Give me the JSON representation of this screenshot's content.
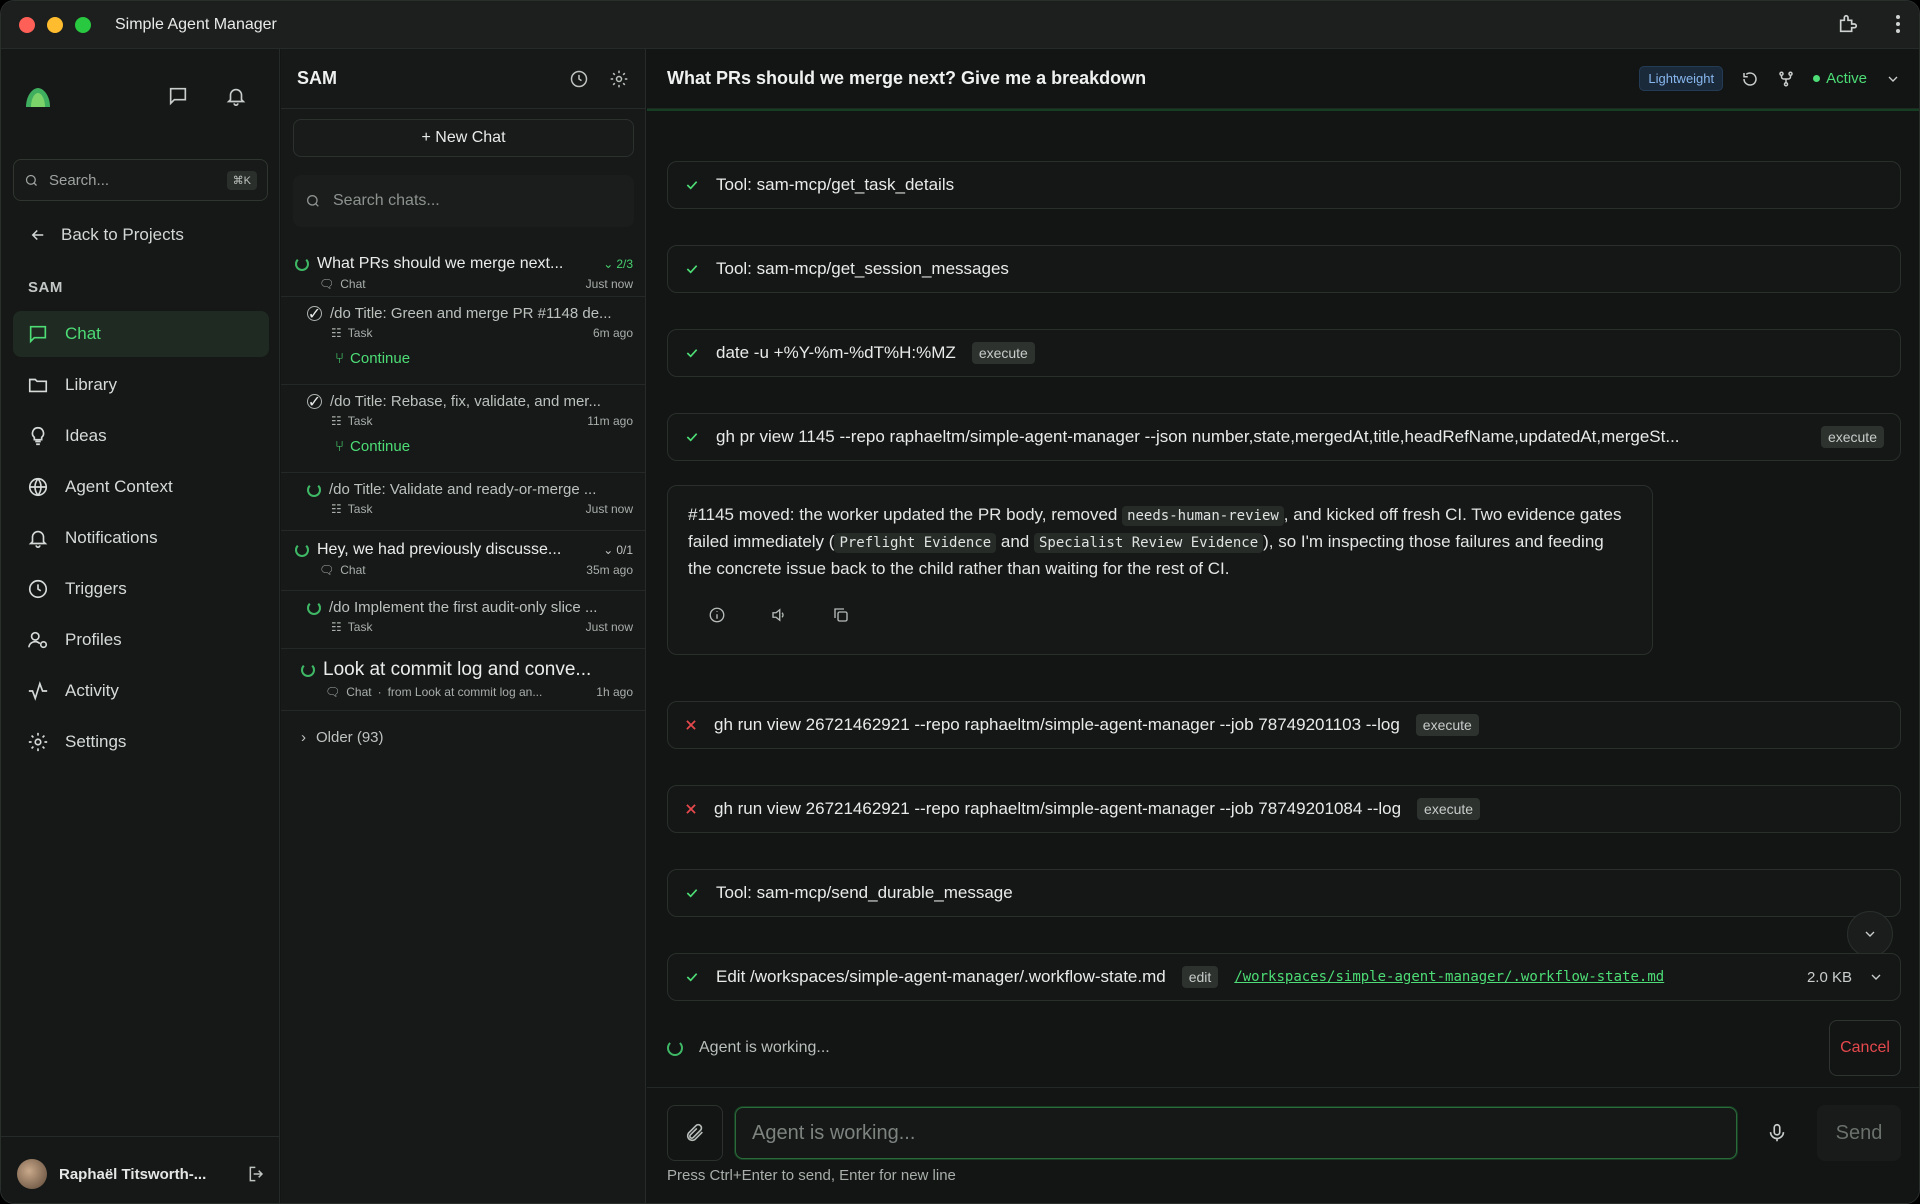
{
  "window": {
    "title": "Simple Agent Manager"
  },
  "sidebar": {
    "search_placeholder": "Search...",
    "search_shortcut": "⌘K",
    "back_label": "Back to Projects",
    "section": "SAM",
    "items": [
      {
        "label": "Chat",
        "icon": "chat-bubble-icon",
        "active": true
      },
      {
        "label": "Library",
        "icon": "folder-icon"
      },
      {
        "label": "Ideas",
        "icon": "lightbulb-icon"
      },
      {
        "label": "Agent Context",
        "icon": "globe-icon"
      },
      {
        "label": "Notifications",
        "icon": "bell-icon"
      },
      {
        "label": "Triggers",
        "icon": "clock-icon"
      },
      {
        "label": "Profiles",
        "icon": "user-gear-icon"
      },
      {
        "label": "Activity",
        "icon": "activity-icon"
      },
      {
        "label": "Settings",
        "icon": "gear-icon"
      }
    ],
    "user_name": "Raphaël Titsworth-..."
  },
  "chatlist": {
    "title": "SAM",
    "new_chat": "+ New Chat",
    "search_placeholder": "Search chats...",
    "threads": [
      {
        "title": "What PRs should we merge next...",
        "count": "2/3",
        "type": "Chat",
        "time": "Just now"
      },
      {
        "title": "/do Title: Green and merge PR #1148 de...",
        "type": "Task",
        "time": "6m ago",
        "action": "Continue"
      },
      {
        "title": "/do Title: Rebase, fix, validate, and mer...",
        "type": "Task",
        "time": "11m ago",
        "action": "Continue"
      },
      {
        "title": "/do Title: Validate and ready-or-merge ...",
        "type": "Task",
        "time": "Just now"
      },
      {
        "title": "Hey, we had previously discusse...",
        "count": "0/1",
        "type": "Chat",
        "time": "35m ago"
      },
      {
        "title": "/do Implement the first audit-only slice ...",
        "type": "Task",
        "time": "Just now"
      },
      {
        "title": "Look at commit log and conve...",
        "type": "Chat",
        "from": "from Look at commit log an...",
        "time": "1h ago"
      }
    ],
    "older": "Older (93)"
  },
  "main": {
    "title": "What PRs should we merge next? Give me a breakdown",
    "badge": "Lightweight",
    "status": "Active",
    "tools": [
      {
        "text": "Tool: sam-mcp/get_task_details",
        "status": "ok"
      },
      {
        "text": "Tool: sam-mcp/get_session_messages",
        "status": "ok"
      },
      {
        "text": "date -u +%Y-%m-%dT%H:%MZ",
        "tag": "execute",
        "status": "ok"
      },
      {
        "text": "gh pr view 1145 --repo raphaeltm/simple-agent-manager --json number,state,mergedAt,title,headRefName,updatedAt,mergeSt...",
        "tag": "execute",
        "status": "ok"
      },
      {
        "text": "gh run view 26721462921 --repo raphaeltm/simple-agent-manager --job 78749201103 --log",
        "tag": "execute",
        "status": "fail"
      },
      {
        "text": "gh run view 26721462921 --repo raphaeltm/simple-agent-manager --job 78749201084 --log",
        "tag": "execute",
        "status": "fail"
      },
      {
        "text": "Tool: sam-mcp/send_durable_message",
        "status": "ok"
      },
      {
        "text": "Edit /workspaces/simple-agent-manager/.workflow-state.md",
        "tag": "edit",
        "link": "/workspaces/simple-agent-manager/.workflow-state.md",
        "size": "2.0 KB",
        "status": "ok"
      }
    ],
    "message": {
      "p1": "#1145 moved: the worker updated the PR body, removed ",
      "c1": "needs-human-review",
      "p2": ", and kicked off fresh CI. Two evidence gates failed immediately (",
      "c2": "Preflight Evidence",
      "p3": " and ",
      "c3": "Specialist Review Evidence",
      "p4": "), so I'm inspecting those failures and feeding the concrete issue back to the child rather than waiting for the rest of CI."
    },
    "working": "Agent is working...",
    "cancel": "Cancel",
    "input_placeholder": "Agent is working...",
    "send": "Send",
    "hint": "Press Ctrl+Enter to send, Enter for new line"
  },
  "colors": {
    "accent": "#4ddc76",
    "danger": "#e5484d",
    "bg": "#121513"
  }
}
